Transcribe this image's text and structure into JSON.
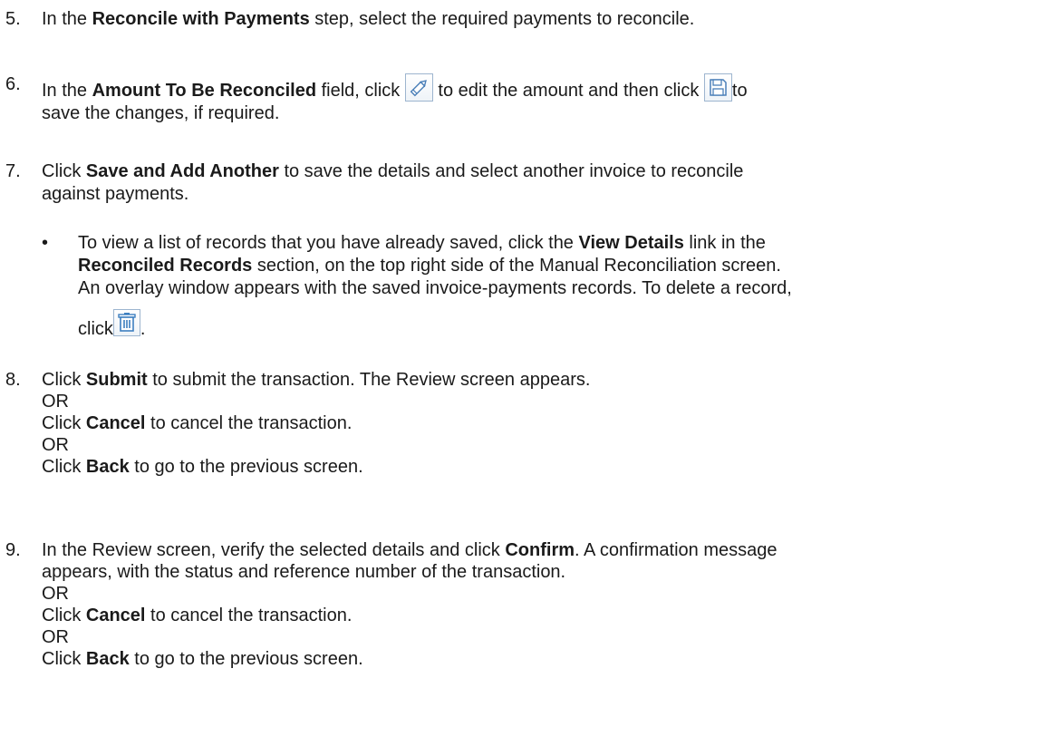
{
  "step5": {
    "number": "5.",
    "pre": "In the ",
    "bold": "Reconcile with Payments",
    "post": " step, select the required payments to reconcile."
  },
  "step6": {
    "number": "6.",
    "pre": "In the ",
    "bold": "Amount To Be Reconciled",
    "mid": " field, click ",
    "mid2": " to edit the amount and then click ",
    "after_save": "to",
    "line2": "save the changes, if required.",
    "edit_icon": "pencil-edit-icon",
    "save_icon": "floppy-save-icon"
  },
  "step7": {
    "number": "7.",
    "pre": "Click ",
    "bold": "Save and Add Another",
    "post": " to save the details and select another invoice to reconcile",
    "line2": "against payments.",
    "bullet": {
      "symbol": "•",
      "l1_pre": "To view a list of records that you have already saved, click the ",
      "l1_bold": "View Details",
      "l1_post": " link in the",
      "l2_bold": "Reconciled Records",
      "l2_post": " section, on the top right side of the Manual Reconciliation screen.",
      "l3": "An overlay window appears with the saved invoice-payments records. To delete a record,",
      "l4_pre": "click",
      "l4_post": ".",
      "delete_icon": "trash-delete-icon"
    }
  },
  "step8": {
    "number": "8.",
    "l1_pre": "Click ",
    "l1_bold": "Submit",
    "l1_post": " to submit the transaction. The Review screen appears.",
    "or1": "OR",
    "l3_pre": "Click ",
    "l3_bold": "Cancel",
    "l3_post": " to cancel the transaction.",
    "or2": "OR",
    "l5_pre": "Click ",
    "l5_bold": "Back",
    "l5_post": " to go to the previous screen."
  },
  "step9": {
    "number": "9.",
    "l1_pre": "In the Review screen, verify the selected details and click ",
    "l1_bold": "Confirm",
    "l1_post": ". A confirmation message",
    "l2": "appears, with the status and reference number of the transaction.",
    "or1": "OR",
    "l4_pre": "Click ",
    "l4_bold": "Cancel",
    "l4_post": " to cancel the transaction.",
    "or2": "OR",
    "l6_pre": "Click ",
    "l6_bold": "Back",
    "l6_post": " to go to the previous screen."
  }
}
